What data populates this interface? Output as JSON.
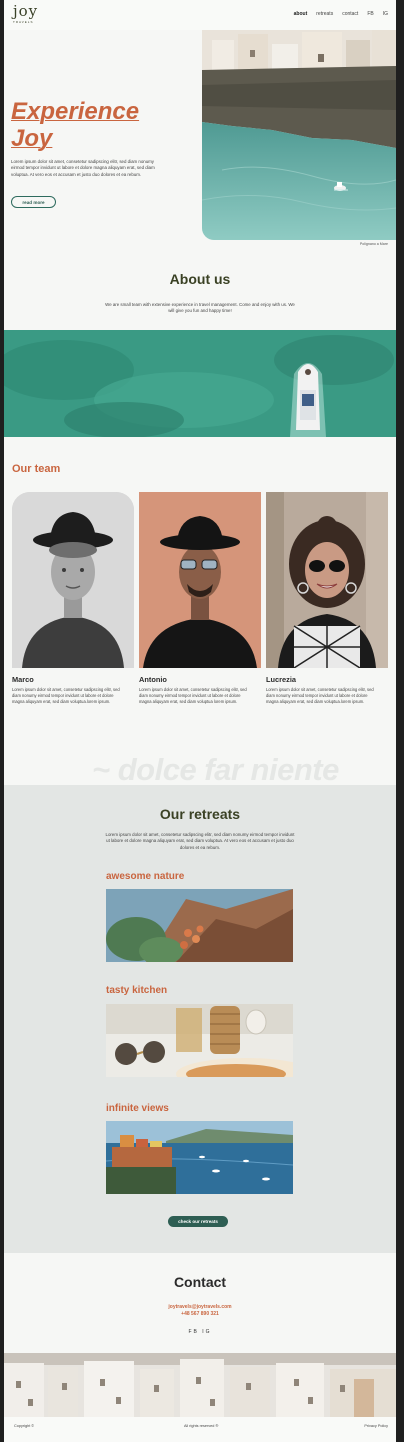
{
  "header": {
    "logo": "joy",
    "logo_sub": "TRAVELS",
    "nav": [
      "about",
      "retreats",
      "contact",
      "FB",
      "IG"
    ]
  },
  "hero": {
    "title_line1": "Experience",
    "title_line2": "Joy",
    "text": "Lorem ipsum dolor sit amet, consetetur sadipscing elitr, sed diam nonumy eirmod tempor invidunt ut labore et dolore magna aliquyam erat, sed diam voluptua. At vero eos et accusam et justo duo dolores et ea rebum.",
    "button": "read more",
    "caption": "Polignano a Mare"
  },
  "about": {
    "title": "About us",
    "text": "We are small team with extensive experience in travel management. Come and enjoy with us. We will give you fun and happy time!"
  },
  "team": {
    "title": "Our team",
    "members": [
      {
        "name": "Marco",
        "desc": "Lorem ipsum dolor sit amet, consetetur sadipscing elitr, sed diam nonumy eirmod tempor invidunt ut labore et dolore magna aliquyam erat, sed diam voluptua.lorem ipsum."
      },
      {
        "name": "Antonio",
        "desc": "Lorem ipsum dolor sit amet, consetetur sadipscing elitr, sed diam nonumy eirmod tempor invidunt ut labore et dolore magna aliquyam erat, sed diam voluptua lorem ipsum."
      },
      {
        "name": "Lucrezia",
        "desc": "Lorem ipsum dolor sit amet, consetetur sadipscing elitr, sed diam nonumy eirmod tempor invidunt ut labore et dolore magna aliquyam erat, sed diam voluptua.lorem ipsum."
      }
    ]
  },
  "motto": "~ dolce far niente",
  "retreats": {
    "title": "Our retreats",
    "text": "Lorem ipsum dolor sit amet, consetetur sadipscing elitr, sed diam nonumy eirmod tempor invidunt ut labore et dolore magna aliquyam erat, sed diam voluptua. At vero eos et accusam et justo duo dolores et ea rebum.",
    "items": [
      "awesome nature",
      "tasty kitchen",
      "infinite views"
    ],
    "button": "check our retreats"
  },
  "contact": {
    "title": "Contact",
    "email": "joytravels@joytravels.com",
    "phone": "+48 567 890 321",
    "social": [
      "FB",
      "IG"
    ]
  },
  "footer": {
    "copyright": "Copyright ©",
    "rights": "All rights reserved ®",
    "privacy": "Privacy Policy"
  },
  "colors": {
    "accent": "#c9653f",
    "dark_green": "#2e5e53",
    "olive": "#3a4124",
    "retreats_bg": "#e3e6e4"
  }
}
